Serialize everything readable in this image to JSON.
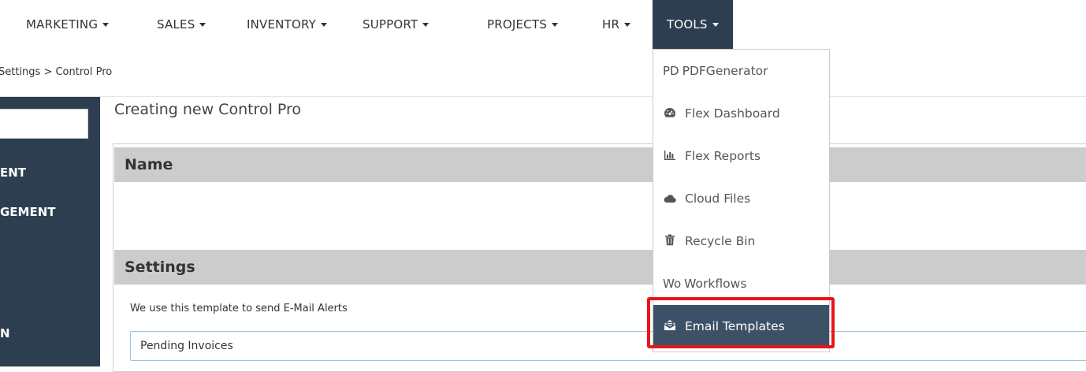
{
  "nav": {
    "items": [
      {
        "label": "MARKETING"
      },
      {
        "label": "SALES"
      },
      {
        "label": "INVENTORY"
      },
      {
        "label": "SUPPORT"
      },
      {
        "label": "PROJECTS"
      },
      {
        "label": "HR"
      },
      {
        "label": "TOOLS",
        "active": true
      }
    ]
  },
  "breadcrumb": {
    "text": "Settings > Control Pro"
  },
  "sidebar": {
    "items": [
      {
        "label": "ENT"
      },
      {
        "label": "GEMENT"
      },
      {
        "label": "N"
      }
    ]
  },
  "main": {
    "title": "Creating new Control Pro",
    "sections": [
      {
        "label": "Name"
      },
      {
        "label": "Settings"
      }
    ],
    "help_text": "We use this template to send E-Mail Alerts",
    "template_value": "Pending Invoices"
  },
  "dropdown": {
    "items": [
      {
        "label": "PDFGenerator",
        "prefix": "PD",
        "icon": "none"
      },
      {
        "label": "Flex Dashboard",
        "icon": "dashboard-icon"
      },
      {
        "label": "Flex Reports",
        "icon": "bar-chart-icon"
      },
      {
        "label": "Cloud Files",
        "icon": "cloud-icon"
      },
      {
        "label": "Recycle Bin",
        "icon": "trash-icon"
      },
      {
        "label": "Workflows",
        "prefix": "Wo",
        "icon": "none"
      },
      {
        "label": "Email Templates",
        "icon": "envelope-open-icon",
        "selected": true
      }
    ]
  },
  "colors": {
    "nav_active_bg": "#2c3e50",
    "sidebar_bg": "#2c3e50",
    "dropdown_selected_bg": "#3d5166",
    "section_header_bg": "#cccccc",
    "highlight_border": "#e8161a"
  }
}
